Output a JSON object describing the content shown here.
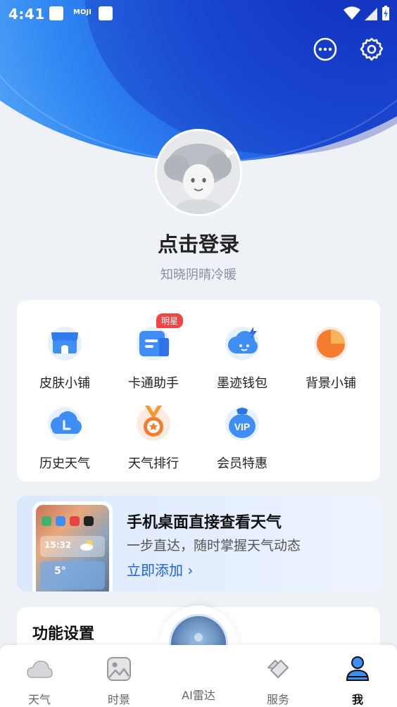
{
  "status_bar": {
    "time": "4:41",
    "app_label": "MOJI"
  },
  "profile": {
    "login_text": "点击登录",
    "subtitle": "知晓阴晴冷暖"
  },
  "grid": {
    "items": [
      {
        "label": "皮肤小铺",
        "icon": "shop-icon"
      },
      {
        "label": "卡通助手",
        "icon": "cartoon-assistant-icon",
        "badge": "明星"
      },
      {
        "label": "墨迹钱包",
        "icon": "wallet-icon"
      },
      {
        "label": "背景小铺",
        "icon": "background-shop-icon"
      },
      {
        "label": "历史天气",
        "icon": "history-weather-icon"
      },
      {
        "label": "天气排行",
        "icon": "weather-ranking-icon"
      },
      {
        "label": "会员特惠",
        "icon": "vip-icon"
      }
    ]
  },
  "promo": {
    "title": "手机桌面直接查看天气",
    "subtitle": "一步直达，随时掌握天气动态",
    "link": "立即添加",
    "phone": {
      "time": "15:32",
      "temp": "5°"
    }
  },
  "feature_settings": {
    "title": "功能设置"
  },
  "tabbar": {
    "tabs": [
      {
        "label": "天气"
      },
      {
        "label": "时景"
      },
      {
        "label": "AI雷达"
      },
      {
        "label": "服务"
      },
      {
        "label": "我"
      }
    ]
  }
}
